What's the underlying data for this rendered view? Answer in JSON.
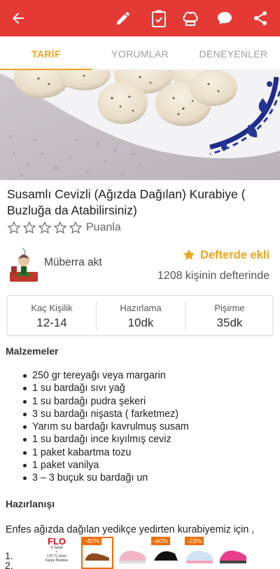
{
  "topbar": {
    "background": "#e53935",
    "icons": [
      "back-arrow-icon",
      "pencil-icon",
      "clipboard-check-icon",
      "chef-hat-icon",
      "chat-bubble-icon",
      "share-icon"
    ]
  },
  "tabs": [
    {
      "label": "TARİF",
      "active": true
    },
    {
      "label": "YORUMLAR",
      "active": false
    },
    {
      "label": "DENEYENLER",
      "active": false
    }
  ],
  "recipe": {
    "title": "Susamlı Cevizli (Ağızda Dağılan) Kurabiye ( Buzluğa da Atabilirsiniz)",
    "rating_label": "Puanla",
    "rating_stars": 0,
    "author": "Müberra akt",
    "saved_label": "Defterde ekli",
    "saved_count": "1208 kişinin defterinde"
  },
  "stats": [
    {
      "label": "Kaç Kişilik",
      "value": "12-14"
    },
    {
      "label": "Hazırlama",
      "value": "10dk"
    },
    {
      "label": "Pişirme",
      "value": "35dk"
    }
  ],
  "ingredients_title": "Malzemeler",
  "ingredients": [
    "250 gr tereyağı veya margarin",
    "1 su bardağı sıvı yağ",
    "1 su bardağı pudra şekeri",
    "3 su bardağı nişasta ( farketmez)",
    "Yarım su bardağı kavrulmuş susam",
    "1 su bardağı ince kıyılmış ceviz",
    "1 paket kabartma tozu",
    "1 paket vanilya",
    "3 – 3 buçuk su bardağı un"
  ],
  "preparation_title": "Hazırlanışı",
  "preparation_intro": "Enfes ağızda dağılan yedikçe yedirten kurabiyemiz için ,",
  "step_numbers": [
    "1.",
    "2."
  ],
  "ad": {
    "brand": "FLO",
    "brand_lines": [
      "6 Taksit",
      "+",
      "175 TL Üzeri",
      "Kargo Bedava"
    ],
    "discounts": [
      "-40%",
      "-40%",
      "-23%"
    ]
  },
  "colors": {
    "accent": "#f2a31c",
    "topbar": "#e53935"
  }
}
